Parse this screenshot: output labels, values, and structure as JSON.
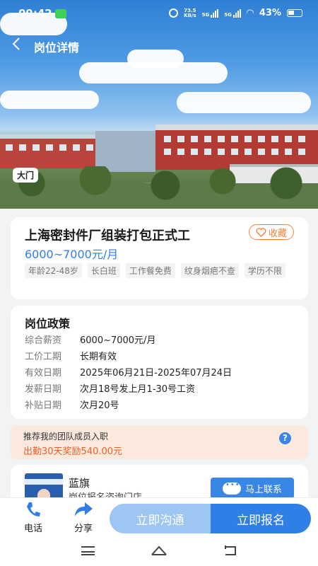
{
  "status_bar": {
    "time": "09:42",
    "net_speed_value": "73.5",
    "net_speed_unit": "KB/s",
    "signal1": "5G",
    "signal2": "5G",
    "battery": "43%"
  },
  "header": {
    "title": "岗位详情",
    "image_tag": "大门"
  },
  "job": {
    "title": "上海密封件厂组装打包正式工",
    "favorite_label": "收藏",
    "salary": "6000~7000元/月",
    "tags": [
      "年龄22-48岁",
      "长白班",
      "工作餐免费",
      "纹身烟疤不查",
      "学历不限"
    ]
  },
  "policy": {
    "title": "岗位政策",
    "rows": [
      {
        "key": "综合薪资",
        "value": "6000~7000元/月"
      },
      {
        "key": "工价工期",
        "value": "长期有效"
      },
      {
        "key": "有效日期",
        "value": "2025年06月21日-2025年07月24日"
      },
      {
        "key": "发薪日期",
        "value": "次月18号发上月1-30号工资"
      },
      {
        "key": "补贴日期",
        "value": "次月20号"
      }
    ]
  },
  "referral": {
    "line1": "推荐我的团队成员入职",
    "line2": "出勤30天奖励540.00元",
    "help": "?"
  },
  "recruiter": {
    "name": "蓝旗",
    "subtitle": "岗位报名咨询门店",
    "contact_label": "马上联系"
  },
  "bottom_bar": {
    "phone_label": "电话",
    "share_label": "分享",
    "chat_label": "立即沟通",
    "apply_label": "立即报名"
  },
  "colors": {
    "accent": "#2f7fe6",
    "accent_light": "#9ec6f3",
    "favorite": "#f0823a",
    "reward": "#e8612a",
    "banner_bg": "#fbe9dd"
  },
  "icons": {
    "back": "chevron-left-icon",
    "favorite": "heart-outline-icon",
    "help": "question-circle-icon",
    "contact": "chat-bubble-icon",
    "phone": "phone-icon",
    "share": "share-arrow-icon"
  }
}
